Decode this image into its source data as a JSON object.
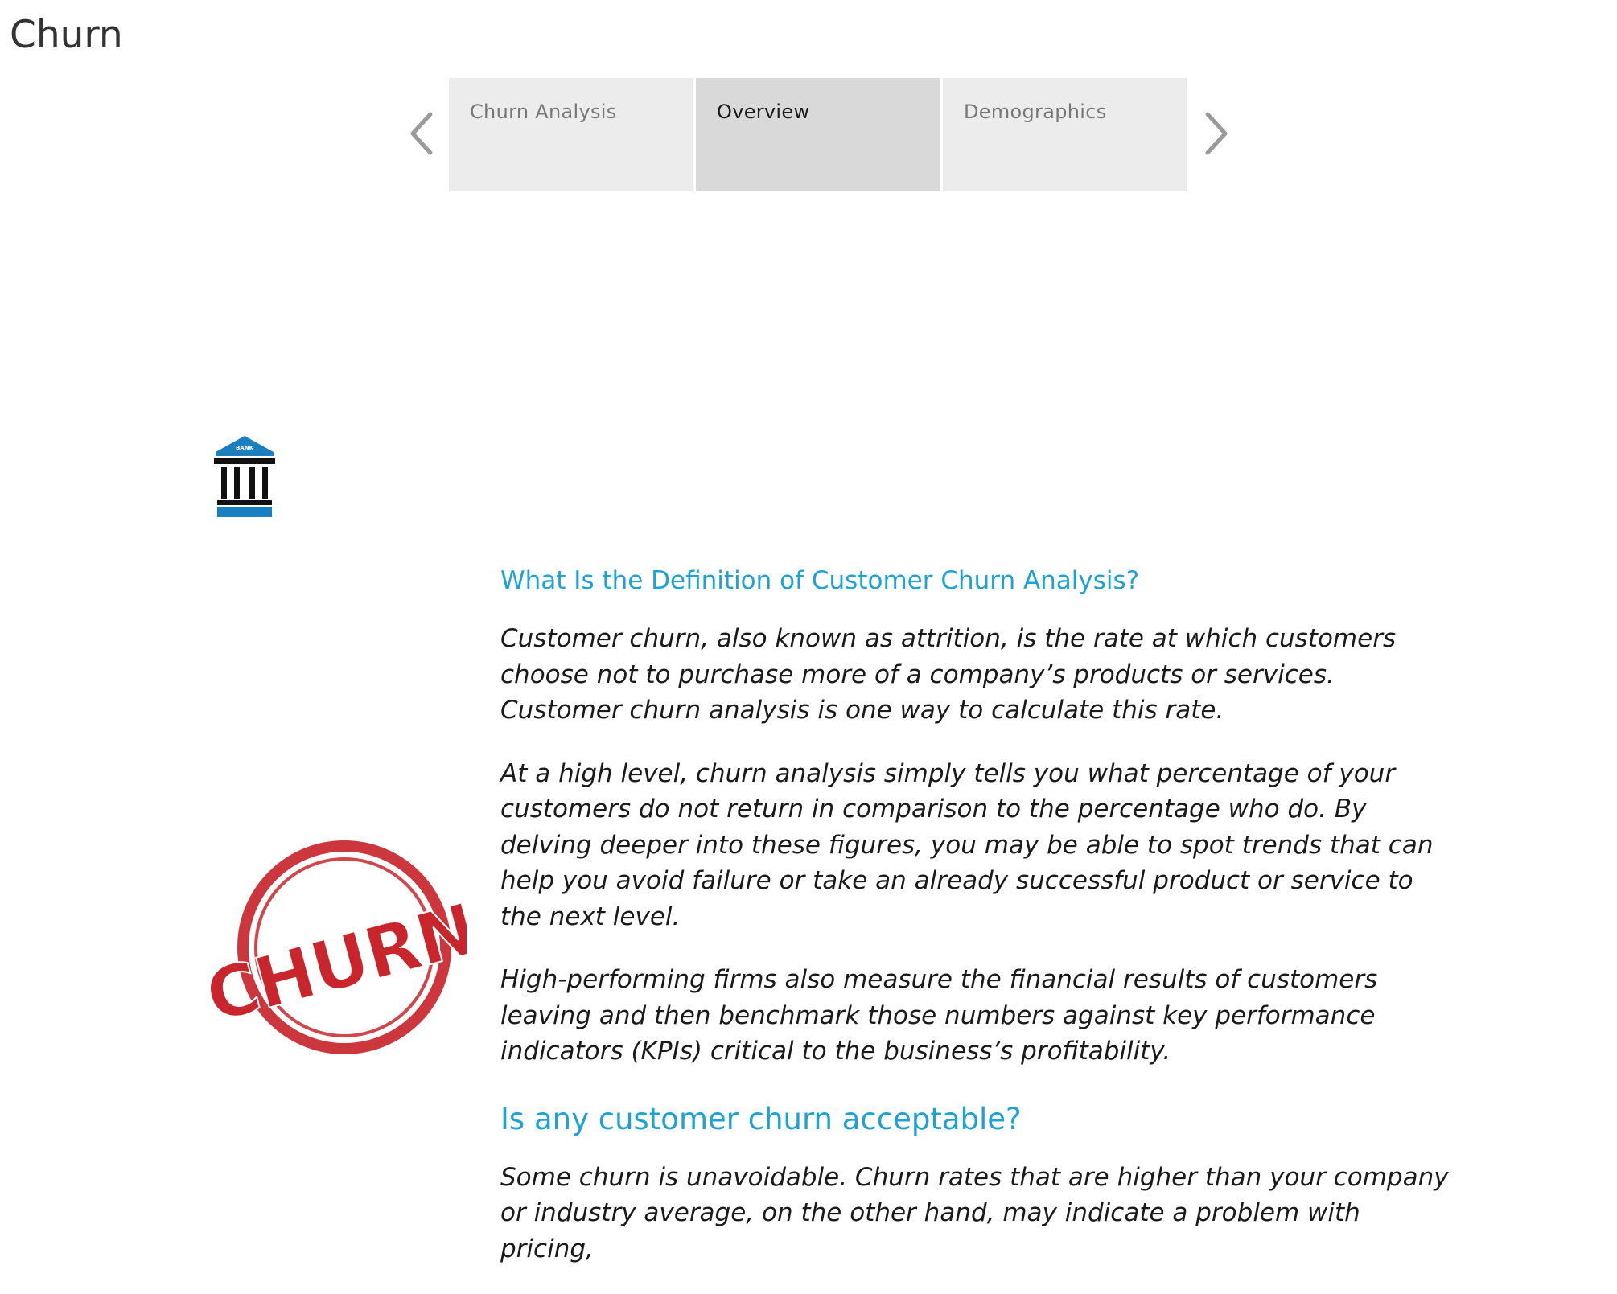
{
  "page": {
    "title": "Churn"
  },
  "tabs": [
    {
      "label": "Churn Analysis",
      "active": false
    },
    {
      "label": "Overview",
      "active": true
    },
    {
      "label": "Demographics",
      "active": false
    }
  ],
  "icons": {
    "prev": "chevron-left-icon",
    "next": "chevron-right-icon",
    "bank": "bank-icon",
    "stamp": "churn-stamp"
  },
  "bank_icon": {
    "caption": "BANK"
  },
  "stamp": {
    "text": "CHURN"
  },
  "content": {
    "heading1": "What Is the Definition of Customer Churn Analysis?",
    "paragraphs": [
      "Customer churn, also known as attrition, is the rate at which customers choose not to purchase more of a company’s products or services. Customer churn analysis is one way to calculate this rate.",
      "At a high level, churn analysis simply tells you what percentage of your customers do not return in comparison to the percentage who do. By delving deeper into these figures, you may be able to spot trends that can help you avoid failure or take an already successful product or service to the next level.",
      "High-performing firms also measure the financial results of customers leaving and then benchmark those numbers against key performance indicators (KPIs) critical to the business’s profitability."
    ],
    "heading2": "Is any customer churn acceptable?",
    "paragraph_last": "Some churn is unavoidable. Churn rates that are higher than your company or industry average, on the other hand, may indicate a problem with pricing,"
  },
  "colors": {
    "accent": "#1ea2d5",
    "tab_bg": "#ececec",
    "tab_active_bg": "#d9d9d9",
    "stamp_red": "#c8262c",
    "bank_blue": "#1a7fc1"
  }
}
